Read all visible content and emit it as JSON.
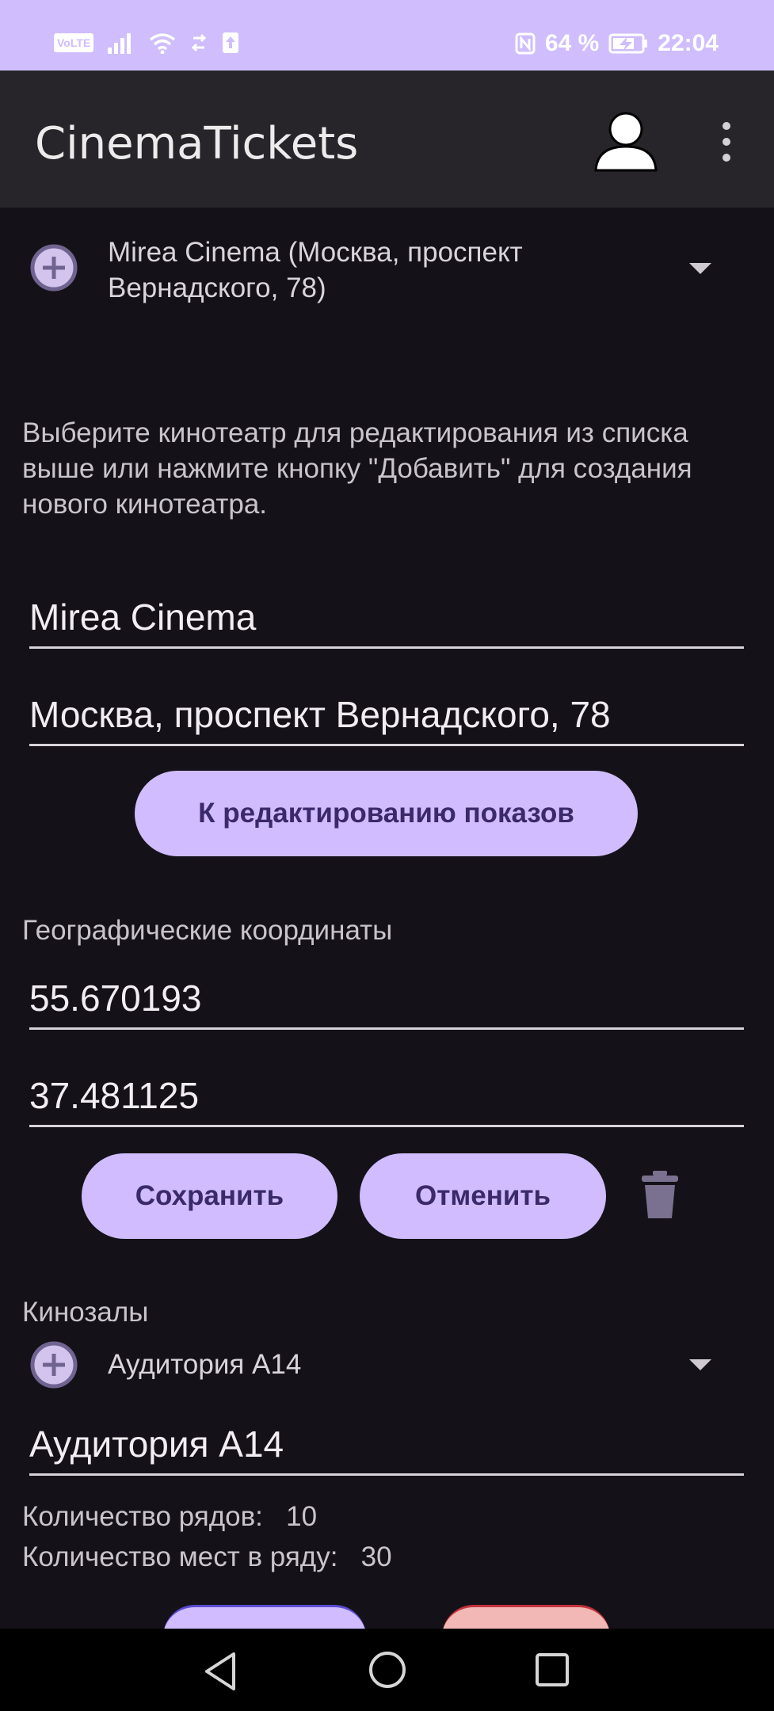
{
  "status_bar": {
    "volte": "VoLTE",
    "battery_percent": "64 %",
    "time": "22:04"
  },
  "app_bar": {
    "title": "CinemaTickets",
    "profile_icon": "person-icon",
    "menu_icon": "more-vert-icon"
  },
  "cinema_selector": {
    "selected": "Mirea Cinema (Москва, проспект Вернадского, 78)"
  },
  "helper_text": "Выберите кинотеатр для редактирования из списка выше или нажмите кнопку \"Добавить\" для создания нового кинотеатра.",
  "cinema_form": {
    "name": "Mirea Cinema",
    "address": "Москва, проспект Вернадского, 78",
    "edit_shows_button": "К редактированию показов",
    "coords_label": "Географические координаты",
    "latitude": "55.670193",
    "longitude": "37.481125",
    "save_button": "Сохранить",
    "cancel_button": "Отменить"
  },
  "halls": {
    "label": "Кинозалы",
    "selected": "Аудитория А14",
    "name": "Аудитория А14",
    "rows_label": "Количество рядов:",
    "rows_value": "10",
    "seats_label": "Количество мест в ряду:",
    "seats_value": "30"
  },
  "colors": {
    "accent": "#d0bcff",
    "status_bar": "#cfbdfd",
    "background": "#141218",
    "app_bar": "#27252a"
  }
}
